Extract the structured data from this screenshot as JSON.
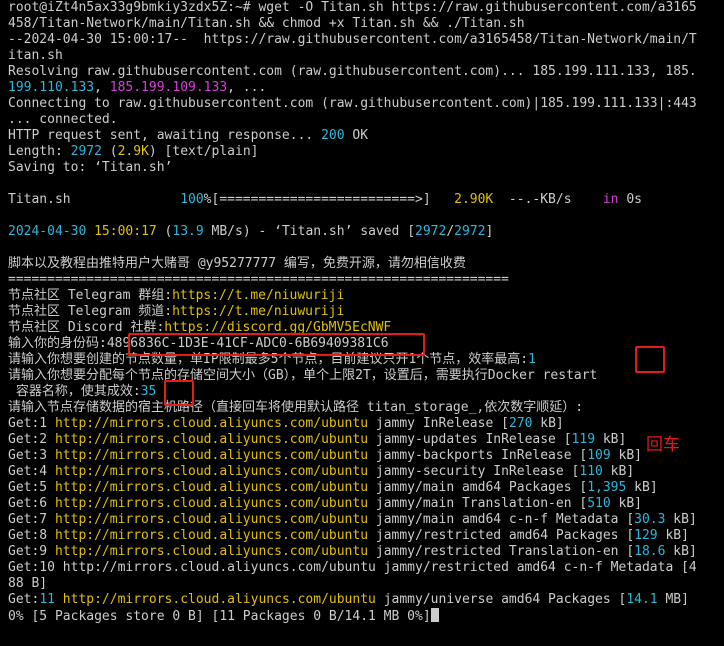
{
  "lines": {
    "l1": "root@iZt4n5ax33g9bmkiy3zdx5Z:~# wget -O Titan.sh https://raw.githubusercontent.com/a3165",
    "l2": "458/Titan-Network/main/Titan.sh && chmod +x Titan.sh && ./Titan.sh",
    "l3": "--2024-04-30 15:00:17--  https://raw.githubusercontent.com/a3165458/Titan-Network/main/T",
    "l4": "itan.sh",
    "l5": "Resolving raw.githubusercontent.com (raw.githubusercontent.com)... 185.199.111.133, 185.",
    "l6a": "199.110.133",
    "l6b": ", ",
    "l6c": "185.199.109.133",
    "l6d": ", ...",
    "l7": "Connecting to raw.githubusercontent.com (raw.githubusercontent.com)|185.199.111.133|:443",
    "l8": "... connected.",
    "l9a": "HTTP request sent, awaiting response... ",
    "l9b": "200",
    "l9c": " OK",
    "l10a": "Length: ",
    "l10b": "2972",
    "l10c": " (",
    "l10d": "2.9K",
    "l10e": ") [text/plain]",
    "l11": "Saving to: ‘Titan.sh’",
    "l12a": "Titan.sh              ",
    "l12b": "100",
    "l12c": "%[=========================>]   ",
    "l12d": "2.90K",
    "l12e": "  --.-KB/s    ",
    "l12f": "in",
    "l12g": " 0s",
    "l13a": "2024-04-30",
    "l13b": " ",
    "l13c": "15:00:17",
    "l13d": " (",
    "l13e": "13.9",
    "l13f": " MB/s) - ‘Titan.sh’ saved [",
    "l13g": "2972",
    "l13h": "/",
    "l13i": "2972",
    "l13j": "]",
    "l14": "脚本以及教程由推特用户大赌哥 @y95277777 编写，免费开源，请勿相信收费",
    "l15": "================================================================",
    "l16a": "节点社区 Telegram 群组:",
    "l16b": "https://t.me/niuwuriji",
    "l17a": "节点社区 Telegram 频道:",
    "l17b": "https://t.me/niuwuriji",
    "l18a": "节点社区 Discord 社群:",
    "l18b": "https://discord.gg/GbMV5EcNWF",
    "l19a": "输入你的身份码:",
    "l19b": "4896836C-1D3E-41CF-ADC0-6B69409381C6",
    "l20a": "请输入你想要创建的节点数量，单IP限制最多5个节点，目前建议只开1个节点，效率最高:",
    "l20b": "1",
    "l21": "请输入你想要分配每个节点的存储空间大小（GB），单个上限2T，设置后，需要执行Docker restart",
    "l22a": " 容器名称，使其成效:",
    "l22b": "35",
    "l23": "请输入节点存储数据的宿主机路径（直接回车将使用默认路径 titan_storage_,依次数字顺延）:",
    "get1a": "Get:1 ",
    "get1b": "http://mirrors.cloud.aliyuncs.com/ubuntu",
    "get1c": " jammy InRelease [",
    "get1d": "270",
    "get1e": " kB]",
    "get2a": "Get:2 ",
    "get2b": "http://mirrors.cloud.aliyuncs.com/ubuntu",
    "get2c": " jammy-updates InRelease [",
    "get2d": "119",
    "get2e": " kB]",
    "get3a": "Get:3 ",
    "get3b": "http://mirrors.cloud.aliyuncs.com/ubuntu",
    "get3c": " jammy-backports InRelease [",
    "get3d": "109",
    "get3e": " kB]",
    "get4a": "Get:4 ",
    "get4b": "http://mirrors.cloud.aliyuncs.com/ubuntu",
    "get4c": " jammy-security InRelease [",
    "get4d": "110",
    "get4e": " kB]",
    "get5a": "Get:5 ",
    "get5b": "http://mirrors.cloud.aliyuncs.com/ubuntu",
    "get5c": " jammy/main amd64 Packages [",
    "get5d": "1,395",
    "get5e": " kB]",
    "get6a": "Get:6 ",
    "get6b": "http://mirrors.cloud.aliyuncs.com/ubuntu",
    "get6c": " jammy/main Translation-en [",
    "get6d": "510",
    "get6e": " kB]",
    "get7a": "Get:7 ",
    "get7b": "http://mirrors.cloud.aliyuncs.com/ubuntu",
    "get7c": " jammy/main amd64 c-n-f Metadata [",
    "get7d": "30.3",
    "get7e": " kB]",
    "get8a": "Get:8 ",
    "get8b": "http://mirrors.cloud.aliyuncs.com/ubuntu",
    "get8c": " jammy/restricted amd64 Packages [",
    "get8d": "129",
    "get8e": " kB]",
    "get9a": "Get:9 ",
    "get9b": "http://mirrors.cloud.aliyuncs.com/ubuntu",
    "get9c": " jammy/restricted Translation-en [",
    "get9d": "18.6",
    "get9e": " kB]",
    "get10": "Get:10 http://mirrors.cloud.aliyuncs.com/ubuntu jammy/restricted amd64 c-n-f Metadata [4",
    "get10b": "88 B]",
    "get11a": "Get:",
    "get11b": "11",
    "get11c": " ",
    "get11d": "http://mirrors.cloud.aliyuncs.com/ubuntu",
    "get11e": " jammy/universe amd64 Packages [",
    "get11f": "14.1",
    "get11g": " MB]",
    "last": "0% [5 Packages store 0 B] [11 Packages 0 B/14.1 MB 0%]"
  },
  "annotation": {
    "enter_label": "回车"
  },
  "colors": {
    "highlight_box": "#e21b1b",
    "green": "#2fd12f",
    "yellow": "#e0c000",
    "cyan": "#29b8db",
    "magenta": "#d63fd6"
  }
}
